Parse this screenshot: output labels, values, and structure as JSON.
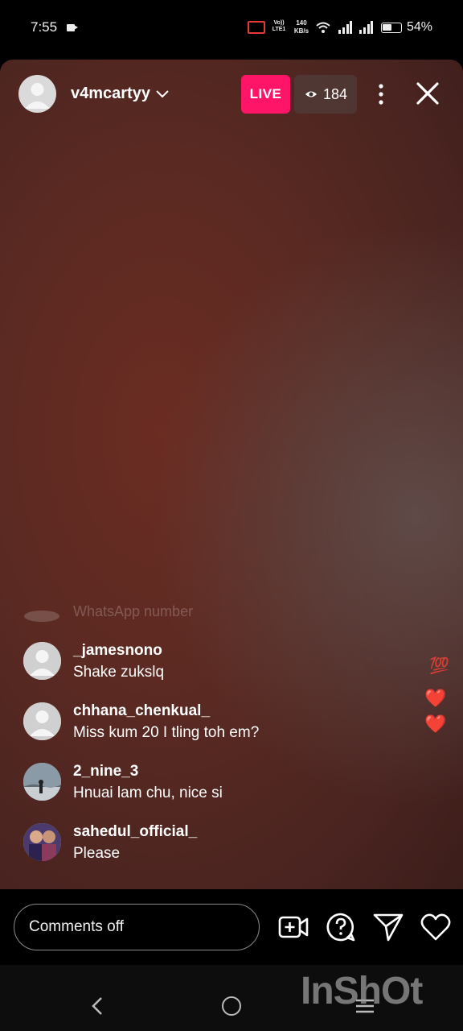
{
  "status_bar": {
    "time": "7:55",
    "volte": "Vo)) LTE1",
    "speed": "140 KB/s",
    "battery": "54%",
    "battery_level": 0.54
  },
  "live_header": {
    "username": "v4mcartyy",
    "live_label": "LIVE",
    "viewer_count": "184",
    "live_color": "#ff1567"
  },
  "comments_faded": "WhatsApp number",
  "comments": [
    {
      "user": "_jamesnono",
      "text": "Shake zukslq"
    },
    {
      "user": "chhana_chenkual_",
      "text": "Miss kum 20 I tling toh em?"
    },
    {
      "user": "2_nine_3",
      "text": "Hnuai lam chu, nice si"
    },
    {
      "user": "sahedul_official_",
      "text": "Please"
    }
  ],
  "reactions": [
    "💯",
    "❤️",
    "❤️"
  ],
  "bottom_bar": {
    "comment_placeholder": "Comments off",
    "icons": [
      "add-video-icon",
      "question-icon",
      "send-icon",
      "heart-icon"
    ]
  },
  "watermark": "InShOt"
}
